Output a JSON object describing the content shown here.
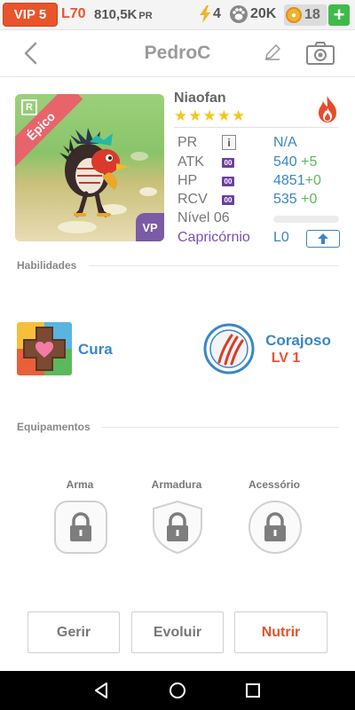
{
  "topbar": {
    "vip": "VIP 5",
    "level": "L70",
    "pr_total": "810,5K",
    "pr_unit": "PR",
    "energy": "4",
    "paws": "20K",
    "coins": "18",
    "add": "+"
  },
  "header": {
    "title": "PedroC"
  },
  "card": {
    "rarity_letter": "R",
    "rarity": "Épico",
    "vp_badge": "VP"
  },
  "monster": {
    "name": "Niaofan",
    "stars": 5,
    "stats": {
      "pr_label": "PR",
      "pr_value": "N/A",
      "atk_label": "ATK",
      "atk_badge": "00",
      "atk_value": "540",
      "atk_bonus": "+5",
      "hp_label": "HP",
      "hp_badge": "00",
      "hp_value": "4851",
      "hp_bonus": "+0",
      "rcv_label": "RCV",
      "rcv_badge": "00",
      "rcv_value": "535",
      "rcv_bonus": "+0",
      "level_label": "Nível 06",
      "level_progress": 0,
      "zodiac_label": "Capricórnio",
      "zodiac_level": "L0"
    }
  },
  "skills": {
    "section_title": "Habilidades",
    "active_name": "Cura",
    "leader_name": "Corajoso",
    "leader_level": "LV 1"
  },
  "equipment": {
    "section_title": "Equipamentos",
    "weapon": "Arma",
    "armor": "Armadura",
    "accessory": "Acessório"
  },
  "actions": {
    "manage": "Gerir",
    "evolve": "Evoluir",
    "feed": "Nutrir"
  },
  "colors": {
    "accent_orange": "#e9542b",
    "accent_blue": "#3a86c6",
    "bonus_green": "#5cb85c",
    "zodiac_purple": "#7a4fb1"
  }
}
